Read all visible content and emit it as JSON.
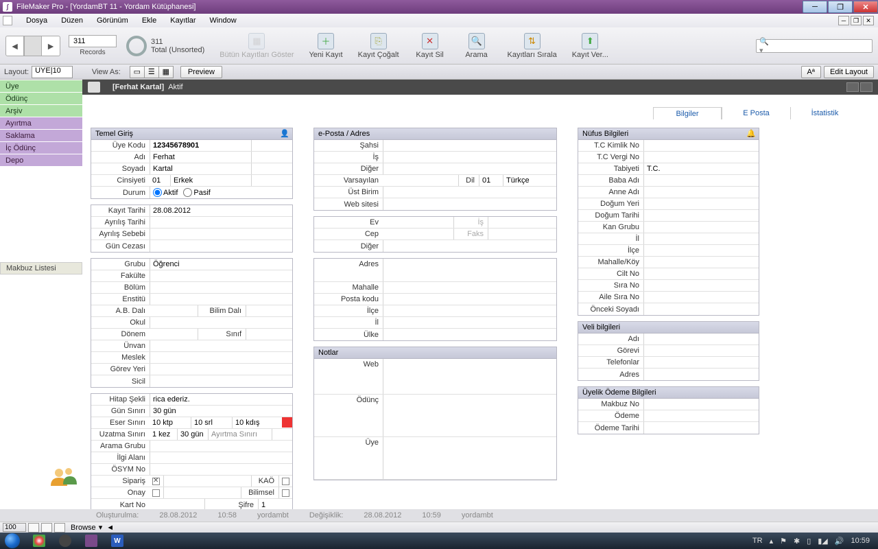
{
  "window": {
    "title": "FileMaker Pro - [YordamBT 11 - Yordam Kütüphanesi]"
  },
  "menu": {
    "items": [
      "Dosya",
      "Düzen",
      "Görünüm",
      "Ekle",
      "Kayıtlar",
      "Window"
    ]
  },
  "toolbar": {
    "record_current": "311",
    "record_total": "311",
    "record_sort": "Total (Unsorted)",
    "records_label": "Records",
    "show_all": "Bütün Kayıtları Göster",
    "new_record": "Yeni Kayıt",
    "dup_record": "Kayıt Çoğalt",
    "del_record": "Kayıt Sil",
    "find": "Arama",
    "sort": "Kayıtları Sırala",
    "import": "Kayıt Ver..."
  },
  "layoutbar": {
    "layout_lbl": "Layout:",
    "layout_val": "UYE|10",
    "viewas": "View As:",
    "preview": "Preview",
    "aa": "Aª",
    "edit": "Edit Layout"
  },
  "header": {
    "name": "[Ferhat Kartal]",
    "status": "Aktif"
  },
  "sidenav": {
    "green": [
      "Üye",
      "Ödünç",
      "Arşiv"
    ],
    "purple": [
      "Ayırtma",
      "Saklama",
      "İç Ödünç",
      "Depo"
    ],
    "receipt": "Makbuz Listesi"
  },
  "tabs": {
    "info": "Bilgiler",
    "eposta": "E Posta",
    "stats": "İstatistik"
  },
  "sec_temel": {
    "hdr": "Temel Giriş",
    "uye_kodu_lbl": "Üye Kodu",
    "uye_kodu": "12345678901",
    "adi_lbl": "Adı",
    "adi": "Ferhat",
    "soyadi_lbl": "Soyadı",
    "soyadi": "Kartal",
    "cinsiyeti_lbl": "Cinsiyeti",
    "cins_kod": "01",
    "cins_val": "Erkek",
    "durum_lbl": "Durum",
    "aktif": "Aktif",
    "pasif": "Pasif"
  },
  "sec_kayit": {
    "kayit_tarihi_lbl": "Kayıt Tarihi",
    "kayit_tarihi": "28.08.2012",
    "ayrilis_tarihi_lbl": "Ayrılış Tarihi",
    "ayrilis_sebebi_lbl": "Ayrılış Sebebi",
    "gun_cezasi_lbl": "Gün Cezası"
  },
  "sec_grup": {
    "grubu_lbl": "Grubu",
    "grubu": "Öğrenci",
    "fakulte_lbl": "Fakülte",
    "bolum_lbl": "Bölüm",
    "enstitu_lbl": "Enstitü",
    "abdali_lbl": "A.B. Dalı",
    "bilimdali_lbl": "Bilim Dalı",
    "okul_lbl": "Okul",
    "donem_lbl": "Dönem",
    "sinif_lbl": "Sınıf",
    "unvan_lbl": "Ünvan",
    "meslek_lbl": "Meslek",
    "gorevyeri_lbl": "Görev Yeri",
    "sicil_lbl": "Sicil"
  },
  "sec_limit": {
    "hitap_lbl": "Hitap Şekli",
    "hitap": "rica ederiz.",
    "gun_siniri_lbl": "Gün Sınırı",
    "gun_siniri": "30 gün",
    "eser_siniri_lbl": "Eser Sınırı",
    "eser1": "10 ktp",
    "eser2": "10 srl",
    "eser3": "10 kdış",
    "uzatma_lbl": "Uzatma Sınırı",
    "uz1": "1 kez",
    "uz2": "30 gün",
    "ayirtma_lbl": "Ayırtma Sınırı",
    "arama_grubu_lbl": "Arama Grubu",
    "ilgi_alani_lbl": "İlgi Alanı",
    "osym_lbl": "ÖSYM No",
    "siparis_lbl": "Sipariş",
    "kao_lbl": "KAÖ",
    "onay_lbl": "Onay",
    "bilimsel_lbl": "Bilimsel",
    "kartno_lbl": "Kart No",
    "sifre_lbl": "Şifre",
    "sifre": "1"
  },
  "sec_eposta": {
    "hdr": "e-Posta / Adres",
    "sahsi": "Şahsi",
    "is": "İş",
    "diger": "Diğer",
    "varsayilan": "Varsayılan",
    "dil_lbl": "Dil",
    "dil_kod": "01",
    "dil_val": "Türkçe",
    "ustbirim": "Üst Birim",
    "web": "Web sitesi"
  },
  "sec_tel": {
    "ev": "Ev",
    "is": "İş",
    "cep": "Cep",
    "faks": "Faks",
    "diger": "Diğer"
  },
  "sec_adres": {
    "adres": "Adres",
    "mahalle": "Mahalle",
    "postakodu": "Posta kodu",
    "ilce": "İlçe",
    "il": "İl",
    "ulke": "Ülke"
  },
  "sec_notlar": {
    "hdr": "Notlar",
    "web": "Web",
    "odunc": "Ödünç",
    "uye": "Üye"
  },
  "sec_nufus": {
    "hdr": "Nüfus Bilgileri",
    "tckimlik": "T.C Kimlik No",
    "tcvergi": "T.C Vergi No",
    "tabiyet_lbl": "Tabiyeti",
    "tabiyet": "T.C.",
    "baba": "Baba Adı",
    "anne": "Anne Adı",
    "dogumyeri": "Doğum Yeri",
    "dogumtarihi": "Doğum Tarihi",
    "kan": "Kan Grubu",
    "il": "İl",
    "ilce": "İlçe",
    "mahalle": "Mahalle/Köy",
    "ciltno": "Cilt No",
    "sirano": "Sıra No",
    "ailesira": "Aile Sıra No",
    "onceki": "Önceki Soyadı"
  },
  "sec_veli": {
    "hdr": "Veli bilgileri",
    "adi": "Adı",
    "gorevi": "Görevi",
    "tel": "Telefonlar",
    "adres": "Adres"
  },
  "sec_odeme": {
    "hdr": "Üyelik Ödeme Bilgileri",
    "makbuz": "Makbuz No",
    "odeme": "Ödeme",
    "tarih": "Ödeme Tarihi"
  },
  "status": {
    "olusturulma_lbl": "Oluşturulma:",
    "o_tarih": "28.08.2012",
    "o_saat": "10:58",
    "o_user": "yordambt",
    "degisiklik_lbl": "Değişiklik:",
    "d_tarih": "28.08.2012",
    "d_saat": "10:59",
    "d_user": "yordambt",
    "zoom": "100",
    "browse": "Browse"
  },
  "taskbar": {
    "lang": "TR",
    "time": "10:59"
  }
}
